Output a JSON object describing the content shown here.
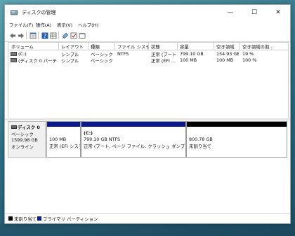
{
  "window": {
    "title": "ディスクの管理",
    "minimize": "—",
    "maximize": "☐",
    "close": "✕"
  },
  "menu": [
    "ファイル(F)",
    "操作(A)",
    "表示(V)",
    "ヘルプ(H)"
  ],
  "toolbar": {
    "icons": [
      "back-arrow-icon",
      "forward-arrow-icon",
      "properties-icon",
      "help-icon",
      "list-view-icon",
      "connect-icon",
      "check-icon",
      "window-icon"
    ]
  },
  "volumes": {
    "columns": [
      "ボリューム",
      "レイアウト",
      "種類",
      "ファイル システム",
      "状態",
      "容量",
      "空き領域",
      "空き領域の割..."
    ],
    "rows": [
      [
        "(C:)",
        "シンプル",
        "ベーシック",
        "NTFS",
        "正常 (ブート...",
        "799.10 GB",
        "154.93 GB",
        "19 %"
      ],
      [
        "(ディスク 0 パーティシ...",
        "シンプル",
        "ベーシック",
        "",
        "正常 (EFI ...",
        "100 MB",
        "100 MB",
        "100 %"
      ]
    ]
  },
  "disk": {
    "name": "ディスク 0",
    "type": "ベーシック",
    "size": "1599.98 GB",
    "status": "オンライン",
    "partitions": [
      {
        "name": "",
        "size": "100 MB",
        "status": "正常 (EFI システ"
      },
      {
        "name": "(C:)",
        "size": "799.10 GB NTFS",
        "status": "正常 (ブート, ページ ファイル, クラッシュ ダンプ, ベーシック"
      },
      {
        "name": "",
        "size": "800.78 GB",
        "status": "未割り当て"
      }
    ]
  },
  "legend": [
    {
      "label": "未割り当て",
      "color": "#000000"
    },
    {
      "label": "プライマリ パーティション",
      "color": "#0a1a8a"
    }
  ],
  "colors": {
    "primary_bar": "#0a1a8a",
    "unallocated_bar": "#000000"
  }
}
